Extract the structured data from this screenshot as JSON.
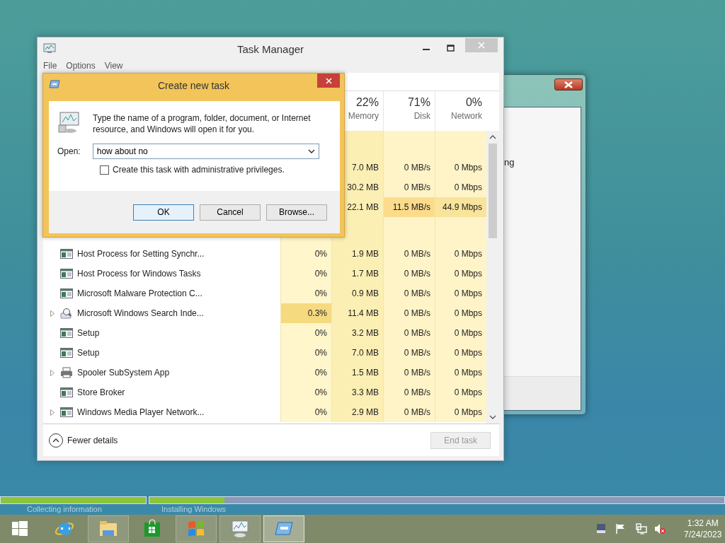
{
  "background_window": {
    "text_fragment": "ng"
  },
  "task_manager": {
    "title": "Task Manager",
    "menu": [
      "File",
      "Options",
      "View"
    ],
    "columns": [
      {
        "percent": "22%",
        "label": "Memory"
      },
      {
        "percent": "71%",
        "label": "Disk"
      },
      {
        "percent": "0%",
        "label": "Network"
      }
    ],
    "rows": [
      {
        "kind": "group"
      },
      {
        "kind": "partial",
        "memory": "7.0 MB",
        "disk": "0 MB/s",
        "network": "0 Mbps",
        "hot_disk": false,
        "hot_network": false
      },
      {
        "kind": "partial",
        "memory": "30.2 MB",
        "disk": "0 MB/s",
        "network": "0 Mbps",
        "hot_disk": false,
        "hot_network": false
      },
      {
        "kind": "partial",
        "memory": "22.1 MB",
        "disk": "11.5 MB/s",
        "network": "44.9 Mbps",
        "hot_disk": true,
        "hot_network": true
      },
      {
        "kind": "group"
      },
      {
        "kind": "window",
        "expandable": false,
        "name": "Host Process for Setting Synchr...",
        "cpu": "0%",
        "memory": "1.9 MB",
        "disk": "0 MB/s",
        "network": "0 Mbps",
        "hot_cpu": false,
        "hot_disk": false,
        "hot_network": false
      },
      {
        "kind": "window",
        "expandable": false,
        "name": "Host Process for Windows Tasks",
        "cpu": "0%",
        "memory": "1.7 MB",
        "disk": "0 MB/s",
        "network": "0 Mbps",
        "hot_cpu": false,
        "hot_disk": false,
        "hot_network": false
      },
      {
        "kind": "window",
        "expandable": false,
        "name": "Microsoft Malware Protection C...",
        "cpu": "0%",
        "memory": "0.9 MB",
        "disk": "0 MB/s",
        "network": "0 Mbps",
        "hot_cpu": false,
        "hot_disk": false,
        "hot_network": false
      },
      {
        "kind": "search",
        "expandable": true,
        "name": "Microsoft Windows Search Inde...",
        "cpu": "0.3%",
        "memory": "11.4 MB",
        "disk": "0 MB/s",
        "network": "0 Mbps",
        "hot_cpu": true,
        "hot_disk": false,
        "hot_network": false
      },
      {
        "kind": "window",
        "expandable": false,
        "name": "Setup",
        "cpu": "0%",
        "memory": "3.2 MB",
        "disk": "0 MB/s",
        "network": "0 Mbps",
        "hot_cpu": false,
        "hot_disk": false,
        "hot_network": false
      },
      {
        "kind": "window",
        "expandable": false,
        "name": "Setup",
        "cpu": "0%",
        "memory": "7.0 MB",
        "disk": "0 MB/s",
        "network": "0 Mbps",
        "hot_cpu": false,
        "hot_disk": false,
        "hot_network": false
      },
      {
        "kind": "printer",
        "expandable": true,
        "name": "Spooler SubSystem App",
        "cpu": "0%",
        "memory": "1.5 MB",
        "disk": "0 MB/s",
        "network": "0 Mbps",
        "hot_cpu": false,
        "hot_disk": false,
        "hot_network": false
      },
      {
        "kind": "window",
        "expandable": false,
        "name": "Store Broker",
        "cpu": "0%",
        "memory": "3.3 MB",
        "disk": "0 MB/s",
        "network": "0 Mbps",
        "hot_cpu": false,
        "hot_disk": false,
        "hot_network": false
      },
      {
        "kind": "window",
        "expandable": true,
        "name": "Windows Media Player Network...",
        "cpu": "0%",
        "memory": "2.9 MB",
        "disk": "0 MB/s",
        "network": "0 Mbps",
        "hot_cpu": false,
        "hot_disk": false,
        "hot_network": false
      }
    ],
    "fewer_details": "Fewer details",
    "end_task": {
      "label": "End task",
      "disabled": true
    }
  },
  "dialog": {
    "title": "Create new task",
    "message": "Type the name of a program, folder, document, or Internet resource, and Windows will open it for you.",
    "open_label": "Open:",
    "open_value": "how about no",
    "admin_checkbox": {
      "label": "Create this task with administrative privileges.",
      "checked": false
    },
    "buttons": [
      {
        "label": "OK",
        "default": true
      },
      {
        "label": "Cancel",
        "default": false
      },
      {
        "label": "Browse...",
        "default": false
      }
    ]
  },
  "setup_progress": {
    "bars": [
      {
        "level": 1
      },
      {
        "level": 0.13
      }
    ],
    "steps": [
      "Collecting information",
      "Installing Windows"
    ]
  },
  "taskbar": {
    "items": [
      {
        "kind": "start",
        "open": false,
        "selected": false
      },
      {
        "kind": "browser",
        "open": false,
        "selected": false
      },
      {
        "kind": "folder",
        "open": true,
        "selected": false
      },
      {
        "kind": "store",
        "open": false,
        "selected": false
      },
      {
        "kind": "setup",
        "open": true,
        "selected": false
      },
      {
        "kind": "taskmgr",
        "open": true,
        "selected": false
      },
      {
        "kind": "run",
        "open": true,
        "selected": true
      }
    ],
    "tray": [
      {
        "kind": "keyboard"
      },
      {
        "kind": "flag"
      },
      {
        "kind": "network"
      },
      {
        "kind": "volume",
        "muted": true
      }
    ],
    "time": "1:32 AM",
    "date": "7/24/2023"
  }
}
